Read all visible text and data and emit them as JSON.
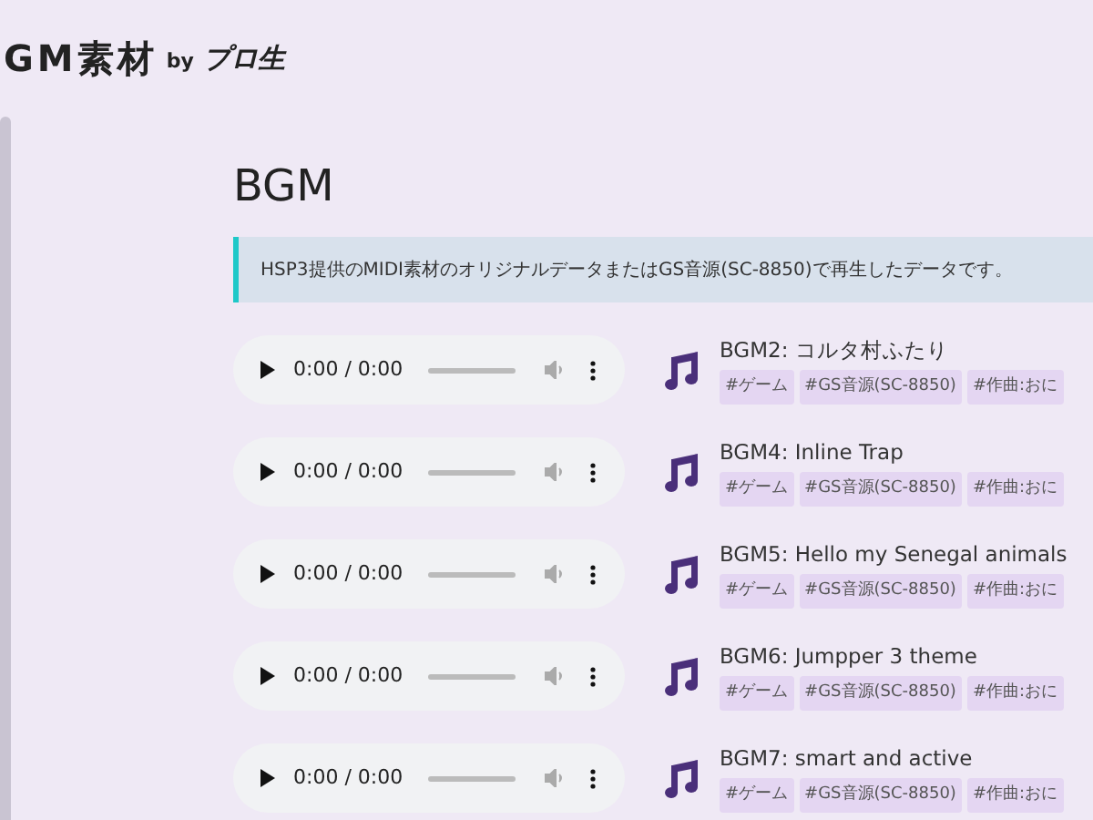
{
  "logo": {
    "title": "GM素材",
    "by": "by",
    "brand": "プロ生"
  },
  "heading": "BGM",
  "notice": "HSP3提供のMIDI素材のオリジナルデータまたはGS音源(SC-8850)で再生したデータです。",
  "tracks": [
    {
      "time": "0:00 / 0:00",
      "title": "BGM2: コルタ村ふたり",
      "tags": [
        "#ゲーム",
        "#GS音源(SC-8850)",
        "#作曲:おに"
      ]
    },
    {
      "time": "0:00 / 0:00",
      "title": "BGM4: Inline Trap",
      "tags": [
        "#ゲーム",
        "#GS音源(SC-8850)",
        "#作曲:おに"
      ]
    },
    {
      "time": "0:00 / 0:00",
      "title": "BGM5: Hello my Senegal animals",
      "tags": [
        "#ゲーム",
        "#GS音源(SC-8850)",
        "#作曲:おに"
      ]
    },
    {
      "time": "0:00 / 0:00",
      "title": "BGM6: Jumpper 3 theme",
      "tags": [
        "#ゲーム",
        "#GS音源(SC-8850)",
        "#作曲:おに"
      ]
    },
    {
      "time": "0:00 / 0:00",
      "title": "BGM7: smart and active",
      "tags": [
        "#ゲーム",
        "#GS音源(SC-8850)",
        "#作曲:おに"
      ]
    }
  ]
}
